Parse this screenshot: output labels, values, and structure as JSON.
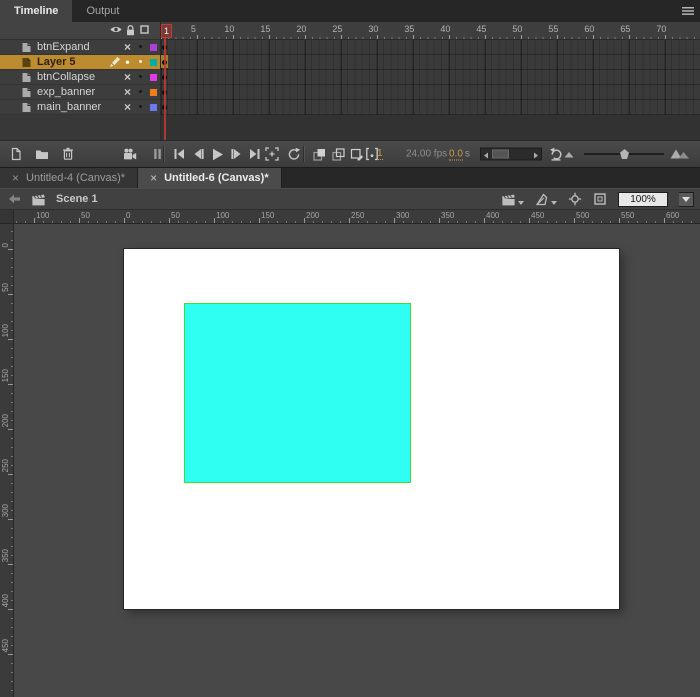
{
  "colors": {
    "accent_orange": "#ce9c4c",
    "selected_layer": "#be8c30",
    "playhead_red": "#c23b35",
    "stage_fill": "#ffffff",
    "shape_fill": "#2ffff2",
    "shape_stroke": "#3cdf35"
  },
  "icons": {
    "close": "×",
    "hidden_mark": "×",
    "dot": "•"
  },
  "panel_tabs": [
    {
      "label": "Timeline",
      "active": true
    },
    {
      "label": "Output",
      "active": false
    }
  ],
  "timeline": {
    "ruler": {
      "frame_numbers": [
        1,
        5,
        10,
        15,
        20,
        25,
        30,
        35,
        40,
        45,
        50,
        55,
        60,
        65,
        70
      ],
      "current_frame": 1
    },
    "layers": [
      {
        "name": "btnExpand",
        "hidden": true,
        "locked": false,
        "editing": false,
        "selected": false,
        "outline_color": "#ae3fd8"
      },
      {
        "name": "Layer 5",
        "hidden": false,
        "locked": false,
        "editing": true,
        "selected": true,
        "outline_color": "#00afa3"
      },
      {
        "name": "btnCollapse",
        "hidden": true,
        "locked": false,
        "editing": false,
        "selected": false,
        "outline_color": "#e23be2"
      },
      {
        "name": "exp_banner",
        "hidden": true,
        "locked": false,
        "editing": false,
        "selected": false,
        "outline_color": "#f07d1a"
      },
      {
        "name": "main_banner",
        "hidden": true,
        "locked": false,
        "editing": false,
        "selected": false,
        "outline_color": "#6e79f0"
      }
    ],
    "status": {
      "current_frame": "1",
      "frame_rate": "24.00 fps",
      "elapsed_time": "0.0",
      "elapsed_unit": "s"
    }
  },
  "document_tabs": [
    {
      "label": "Untitled-4 (Canvas)*",
      "active": false
    },
    {
      "label": "Untitled-6 (Canvas)*",
      "active": true
    }
  ],
  "edit_bar": {
    "scene_label": "Scene 1",
    "zoom_value": "100%"
  },
  "rulers": {
    "horizontal_labels": [
      "100",
      "50",
      "0",
      "50",
      "100",
      "150",
      "200",
      "250",
      "300",
      "350",
      "400",
      "450",
      "500",
      "550",
      "600"
    ],
    "vertical_labels": [
      "0",
      "50",
      "100",
      "150",
      "200",
      "250",
      "300",
      "350",
      "400",
      "450"
    ]
  }
}
